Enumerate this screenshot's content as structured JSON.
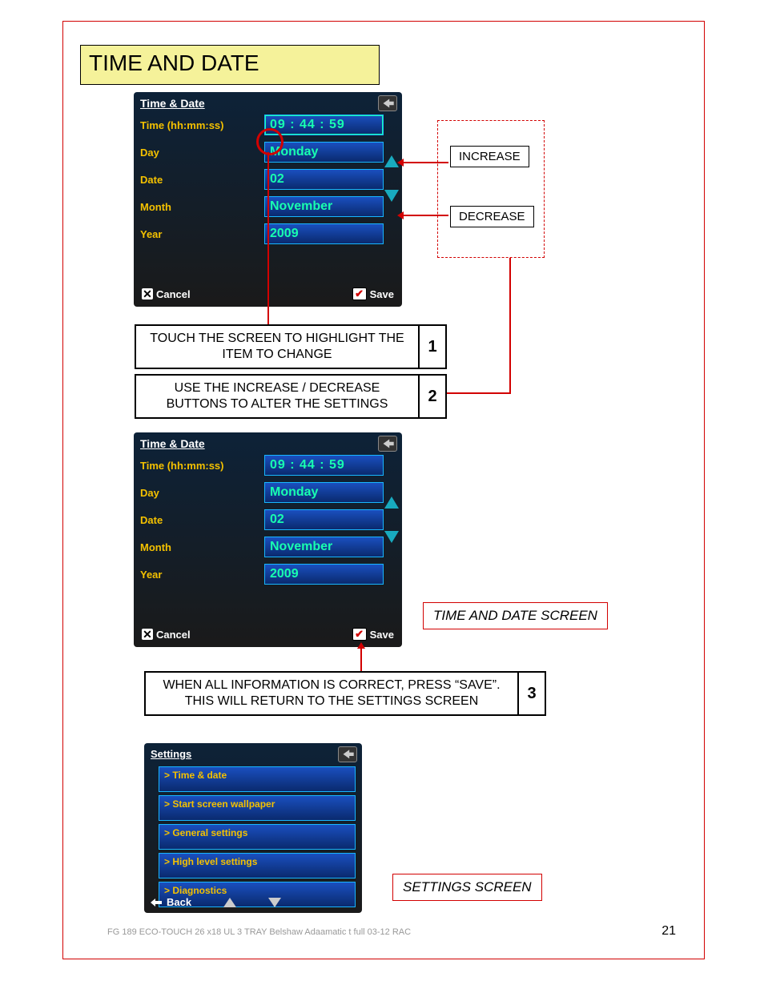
{
  "section_title": "TIME AND DATE",
  "panel": {
    "title": "Time & Date",
    "rows": {
      "time_lbl": "Time (hh:mm:ss)",
      "time_val": "09 : 44 : 59",
      "day_lbl": "Day",
      "day_val": "Monday",
      "date_lbl": "Date",
      "date_val": "02",
      "month_lbl": "Month",
      "month_val": "November",
      "year_lbl": "Year",
      "year_val": "2009"
    },
    "cancel": "Cancel",
    "save": "Save"
  },
  "callouts": {
    "increase": "INCREASE",
    "decrease": "DECREASE"
  },
  "steps": {
    "s1": "TOUCH THE SCREEN TO HIGHLIGHT THE ITEM TO CHANGE",
    "n1": "1",
    "s2": "USE THE INCREASE / DECREASE BUTTONS TO ALTER THE SETTINGS",
    "n2": "2",
    "s3": "WHEN ALL INFORMATION IS CORRECT, PRESS “SAVE”.\nTHIS WILL RETURN TO THE SETTINGS SCREEN",
    "n3": "3"
  },
  "labels": {
    "td": "TIME AND DATE SCREEN",
    "set": "SETTINGS SCREEN"
  },
  "settings": {
    "title": "Settings",
    "items": [
      "> Time & date",
      "> Start screen wallpaper",
      "> General settings",
      "> High level settings",
      "> Diagnostics"
    ],
    "back": "Back"
  },
  "footer": "FG 189 ECO-TOUCH 26 x18 UL 3 TRAY Belshaw Adaamatic t full 03-12 RAC",
  "pagenum": "21"
}
